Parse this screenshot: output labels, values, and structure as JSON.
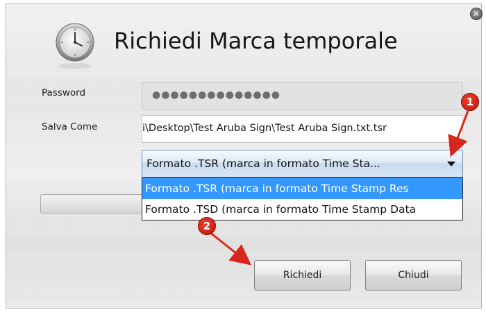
{
  "window": {
    "title": "Richiedi Marca temporale",
    "close_glyph": "✕"
  },
  "form": {
    "password_label": "Password",
    "password_value": "●●●●●●●●●●●●●●",
    "save_as_label": "Salva Come",
    "save_as_value": "i\\Desktop\\Test Aruba Sign\\Test Aruba Sign.txt.tsr"
  },
  "format_select": {
    "selected_value": "Formato .TSR (marca in formato Time Sta...",
    "options": [
      {
        "label": "Formato .TSR (marca in formato Time Stamp Res",
        "highlighted": true
      },
      {
        "label": "Formato .TSD (marca in formato Time Stamp Data",
        "highlighted": false
      }
    ]
  },
  "buttons": {
    "request_label": "Richiedi",
    "close_label": "Chiudi"
  },
  "annotations": [
    {
      "number": "1",
      "color": "#d9261c"
    },
    {
      "number": "2",
      "color": "#d9261c"
    }
  ],
  "icons": {
    "clock": "clock-icon",
    "close": "close-icon",
    "dropdown": "chevron-down-icon"
  }
}
